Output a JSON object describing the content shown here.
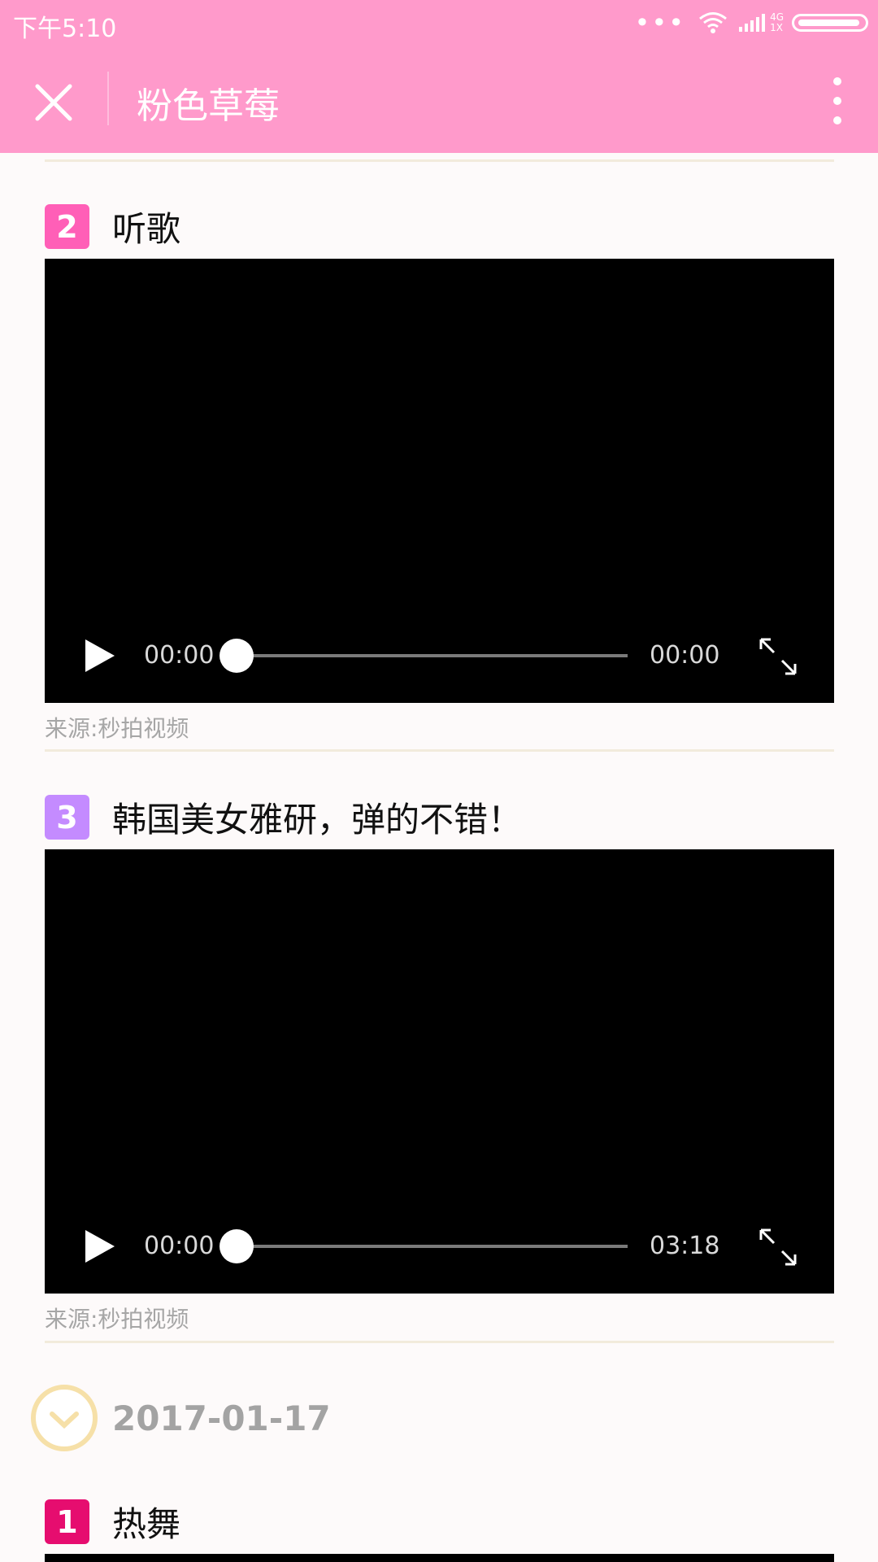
{
  "status": {
    "time": "下午5:10",
    "net_top": "4G",
    "net_bottom": "1X"
  },
  "nav": {
    "title": "粉色草莓"
  },
  "sections": [
    {
      "number": "2",
      "badge_color": "#ff5fb7",
      "title": "听歌",
      "video": {
        "current": "00:00",
        "duration": "00:00"
      },
      "source": "来源:秒拍视频"
    },
    {
      "number": "3",
      "badge_color": "#c48bff",
      "title": "韩国美女雅研，弹的不错！",
      "video": {
        "current": "00:00",
        "duration": "03:18"
      },
      "source": "来源:秒拍视频"
    }
  ],
  "date_group": {
    "date": "2017-01-17",
    "first_item": {
      "number": "1",
      "badge_color": "#e60d6f",
      "title": "热舞"
    }
  }
}
